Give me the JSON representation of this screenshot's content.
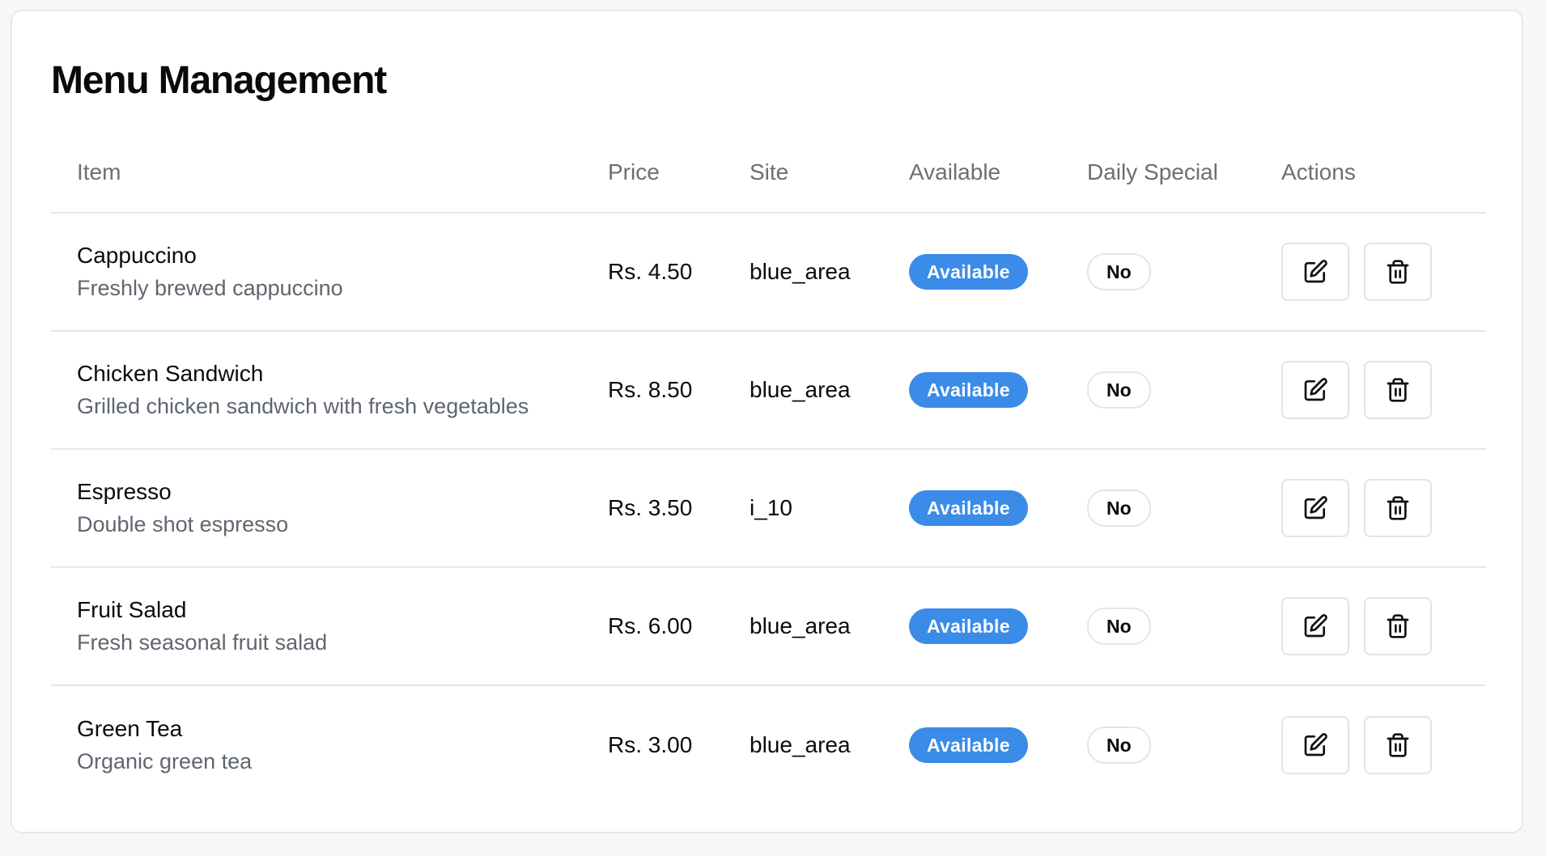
{
  "page": {
    "title": "Menu Management"
  },
  "table": {
    "headers": {
      "item": "Item",
      "price": "Price",
      "site": "Site",
      "available": "Available",
      "daily_special": "Daily Special",
      "actions": "Actions"
    },
    "rows": [
      {
        "name": "Cappuccino",
        "description": "Freshly brewed cappuccino",
        "price": "Rs. 4.50",
        "site": "blue_area",
        "available": "Available",
        "daily_special": "No"
      },
      {
        "name": "Chicken Sandwich",
        "description": "Grilled chicken sandwich with fresh vegetables",
        "price": "Rs. 8.50",
        "site": "blue_area",
        "available": "Available",
        "daily_special": "No"
      },
      {
        "name": "Espresso",
        "description": "Double shot espresso",
        "price": "Rs. 3.50",
        "site": "i_10",
        "available": "Available",
        "daily_special": "No"
      },
      {
        "name": "Fruit Salad",
        "description": "Fresh seasonal fruit salad",
        "price": "Rs. 6.00",
        "site": "blue_area",
        "available": "Available",
        "daily_special": "No"
      },
      {
        "name": "Green Tea",
        "description": "Organic green tea",
        "price": "Rs. 3.00",
        "site": "blue_area",
        "available": "Available",
        "daily_special": "No"
      }
    ]
  },
  "icons": {
    "edit": "edit-icon",
    "delete": "trash-icon"
  },
  "colors": {
    "available_badge": "#3b8be8",
    "background": "#f6f7f9",
    "card": "#ffffff"
  }
}
